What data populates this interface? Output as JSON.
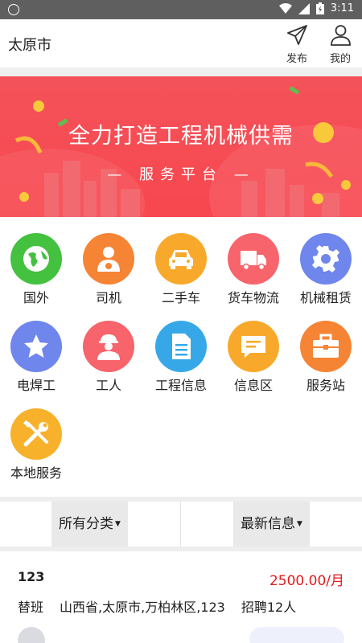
{
  "status_bar": {
    "time": "3:11"
  },
  "header": {
    "city": "太原市",
    "publish_label": "发布",
    "mine_label": "我的"
  },
  "banner": {
    "title": "全力打造工程机械供需",
    "subtitle": "— 服务平台 —"
  },
  "categories": [
    {
      "label": "国外",
      "icon": "globe-icon",
      "color": "#43c13f"
    },
    {
      "label": "司机",
      "icon": "driver-icon",
      "color": "#f68435"
    },
    {
      "label": "二手车",
      "icon": "car-icon",
      "color": "#f8a92b"
    },
    {
      "label": "货车物流",
      "icon": "truck-icon",
      "color": "#f7646b"
    },
    {
      "label": "机械租赁",
      "icon": "gear-icon",
      "color": "#6f86ec"
    },
    {
      "label": "电焊工",
      "icon": "star-icon",
      "color": "#6f86ec"
    },
    {
      "label": "工人",
      "icon": "worker-icon",
      "color": "#f7646b"
    },
    {
      "label": "工程信息",
      "icon": "document-icon",
      "color": "#36a8e8"
    },
    {
      "label": "信息区",
      "icon": "message-icon",
      "color": "#f8a92b"
    },
    {
      "label": "服务站",
      "icon": "toolbox-icon",
      "color": "#f68435"
    },
    {
      "label": "本地服务",
      "icon": "tools-icon",
      "color": "#f8b12b"
    }
  ],
  "filters": {
    "category_label": "所有分类",
    "sort_label": "最新信息"
  },
  "post": {
    "title": "123",
    "price": "2500.00/月",
    "type": "替班",
    "location": "山西省,太原市,万柏林区,123",
    "hiring": "招聘12人"
  }
}
